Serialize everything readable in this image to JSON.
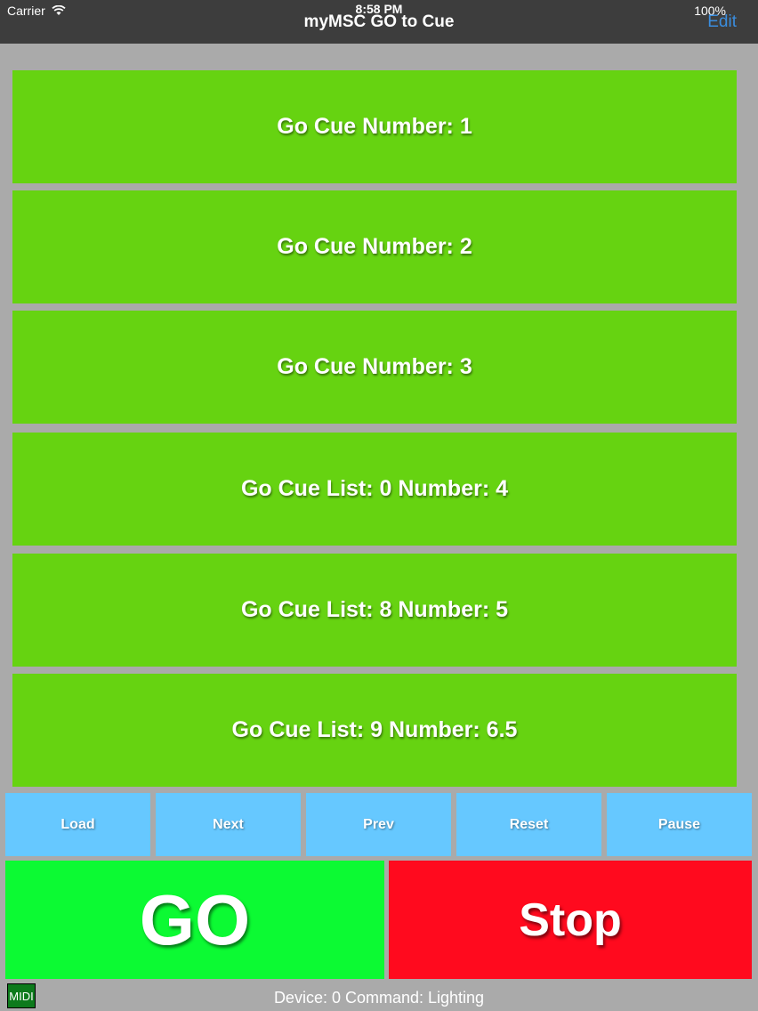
{
  "status_bar": {
    "carrier": "Carrier",
    "time": "8:58 PM",
    "battery": "100%"
  },
  "nav": {
    "title": "myMSC GO to Cue",
    "edit_label": "Edit"
  },
  "cues": [
    "Go Cue Number: 1",
    "Go Cue Number: 2",
    "Go Cue Number: 3",
    "Go Cue List: 0 Number: 4",
    "Go Cue List: 8 Number: 5",
    "Go Cue List: 9 Number: 6.5"
  ],
  "controls": {
    "load": "Load",
    "next": "Next",
    "prev": "Prev",
    "reset": "Reset",
    "pause": "Pause"
  },
  "actions": {
    "go": "GO",
    "stop": "Stop"
  },
  "footer": {
    "midi": "MIDI",
    "status": "Device: 0 Command: Lighting"
  },
  "colors": {
    "cue_green": "#66d311",
    "control_blue": "#66c8ff",
    "go_green": "#0cfa33",
    "stop_red": "#ff0a1e",
    "nav_bg": "#3d3d3d",
    "accent": "#3a8dde"
  }
}
